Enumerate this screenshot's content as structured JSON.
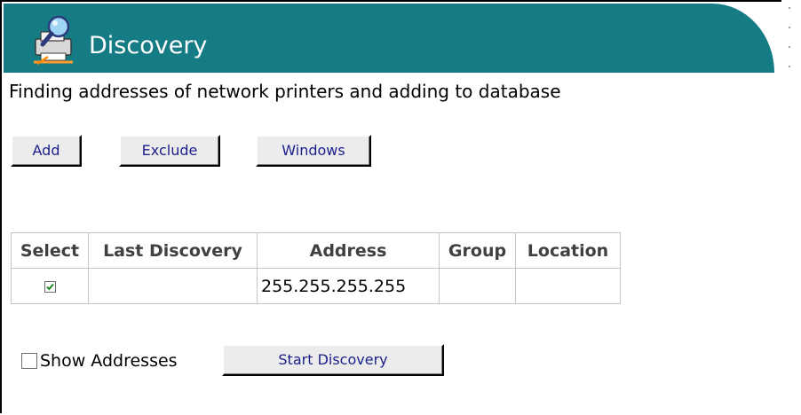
{
  "header": {
    "title": "Discovery",
    "icon": "discovery-printer-magnifier-icon",
    "color": "#157b84"
  },
  "description": "Finding addresses of network printers and adding to database",
  "toolbar": {
    "add_label": "Add",
    "exclude_label": "Exclude",
    "windows_label": "Windows"
  },
  "table": {
    "columns": [
      "Select",
      "Last Discovery",
      "Address",
      "Group",
      "Location"
    ],
    "rows": [
      {
        "selected": true,
        "last_discovery": "",
        "address": "255.255.255.255",
        "group": "",
        "location": ""
      }
    ]
  },
  "footer": {
    "show_addresses_label": "Show Addresses",
    "show_addresses_checked": false,
    "start_label": "Start Discovery"
  }
}
